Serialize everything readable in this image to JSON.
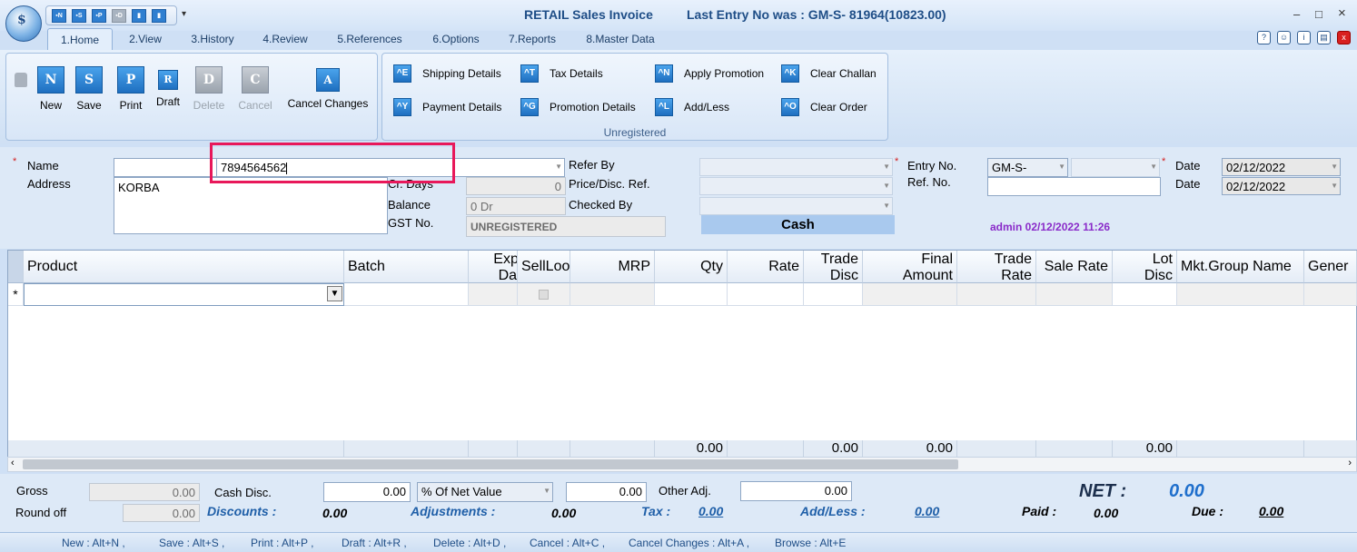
{
  "window": {
    "title": "RETAIL Sales Invoice",
    "last_entry": "Last Entry No was : GM-S- 81964(10823.00)",
    "minimize": "–",
    "maximize": "□",
    "close": "×"
  },
  "quick_access": [
    "N",
    "S",
    "P",
    "D",
    "",
    "",
    ""
  ],
  "tabs": [
    {
      "label": "1.Home"
    },
    {
      "label": "2.View"
    },
    {
      "label": "3.History"
    },
    {
      "label": "4.Review"
    },
    {
      "label": "5.References"
    },
    {
      "label": "6.Options"
    },
    {
      "label": "7.Reports"
    },
    {
      "label": "8.Master Data"
    }
  ],
  "ribbon": {
    "buttons": [
      {
        "icon": "N",
        "label": "New",
        "enabled": true
      },
      {
        "icon": "S",
        "label": "Save",
        "enabled": true
      },
      {
        "icon": "P",
        "label": "Print",
        "enabled": true
      },
      {
        "icon": "R",
        "label": "Draft",
        "enabled": true
      },
      {
        "icon": "D",
        "label": "Delete",
        "enabled": false
      },
      {
        "icon": "C",
        "label": "Cancel",
        "enabled": false
      },
      {
        "icon": "A",
        "label": "Cancel Changes",
        "enabled": true
      }
    ],
    "unregistered_group": {
      "label": "Unregistered",
      "items": [
        {
          "icon": "^E",
          "label": "Shipping Details"
        },
        {
          "icon": "^T",
          "label": "Tax Details"
        },
        {
          "icon": "^N",
          "label": "Apply Promotion"
        },
        {
          "icon": "^K",
          "label": "Clear Challan"
        },
        {
          "icon": "^Y",
          "label": "Payment Details"
        },
        {
          "icon": "^G",
          "label": "Promotion Details"
        },
        {
          "icon": "^L",
          "label": "Add/Less"
        },
        {
          "icon": "^O",
          "label": "Clear Order"
        }
      ]
    }
  },
  "form": {
    "name_label": "Name",
    "name_value": "7894564562",
    "address_label": "Address",
    "address_value": "KORBA",
    "cr_days_label": "Cr. Days",
    "cr_days_value": "0",
    "balance_label": "Balance",
    "balance_value": "0 Dr",
    "gst_label": "GST No.",
    "gst_value": "UNREGISTERED",
    "refer_by_label": "Refer By",
    "price_disc_label": "Price/Disc. Ref.",
    "checked_by_label": "Checked By",
    "cash_label": "Cash",
    "entry_no_label": "Entry No.",
    "entry_no_prefix": "GM-S-",
    "ref_no_label": "Ref. No.",
    "date_label": "Date",
    "date1": "02/12/2022",
    "date2_label": "Date",
    "date2": "02/12/2022",
    "admin_stamp": "admin 02/12/2022 11:26"
  },
  "grid": {
    "columns": [
      "Product",
      "Batch",
      "Expiry Date",
      "SellLoo",
      "MRP",
      "Qty",
      "Rate",
      "Trade Disc",
      "Final Amount",
      "Trade Rate",
      "Sale Rate",
      "Lot Disc",
      "Mkt.Group Name",
      "Gener"
    ],
    "new_row_marker": "*",
    "footer": {
      "qty": "0.00",
      "trade_disc": "0.00",
      "final_amount": "0.00",
      "lot_disc": "0.00"
    }
  },
  "totals": {
    "gross_label": "Gross",
    "gross_value": "0.00",
    "round_off_label": "Round off",
    "round_off_value": "0.00",
    "cash_disc_label": "Cash Disc.",
    "cash_disc_value": "0.00",
    "cash_disc_mode": "% Of Net Value",
    "cash_disc_amount": "0.00",
    "other_adj_label": "Other Adj.",
    "other_adj_value": "0.00",
    "discounts_label": "Discounts :",
    "discounts_value": "0.00",
    "adjustments_label": "Adjustments :",
    "adjustments_value": "0.00",
    "tax_label": "Tax :",
    "tax_value": "0.00",
    "addless_label": "Add/Less :",
    "addless_value": "0.00",
    "net_label": "NET :",
    "net_value": "0.00",
    "paid_label": "Paid :",
    "paid_value": "0.00",
    "due_label": "Due :",
    "due_value": "0.00"
  },
  "status_bar": [
    "New : Alt+N ,",
    "Save : Alt+S ,",
    "Print : Alt+P ,",
    "Draft : Alt+R ,",
    "Delete : Alt+D ,",
    "Cancel : Alt+C ,",
    "Cancel Changes : Alt+A ,",
    "Browse : Alt+E"
  ],
  "colors": {
    "highlight_box": "#e8185a",
    "title_blue": "#1f4e87",
    "admin_purple": "#8a2bc9",
    "cash_bar": "#a9c9ee"
  }
}
